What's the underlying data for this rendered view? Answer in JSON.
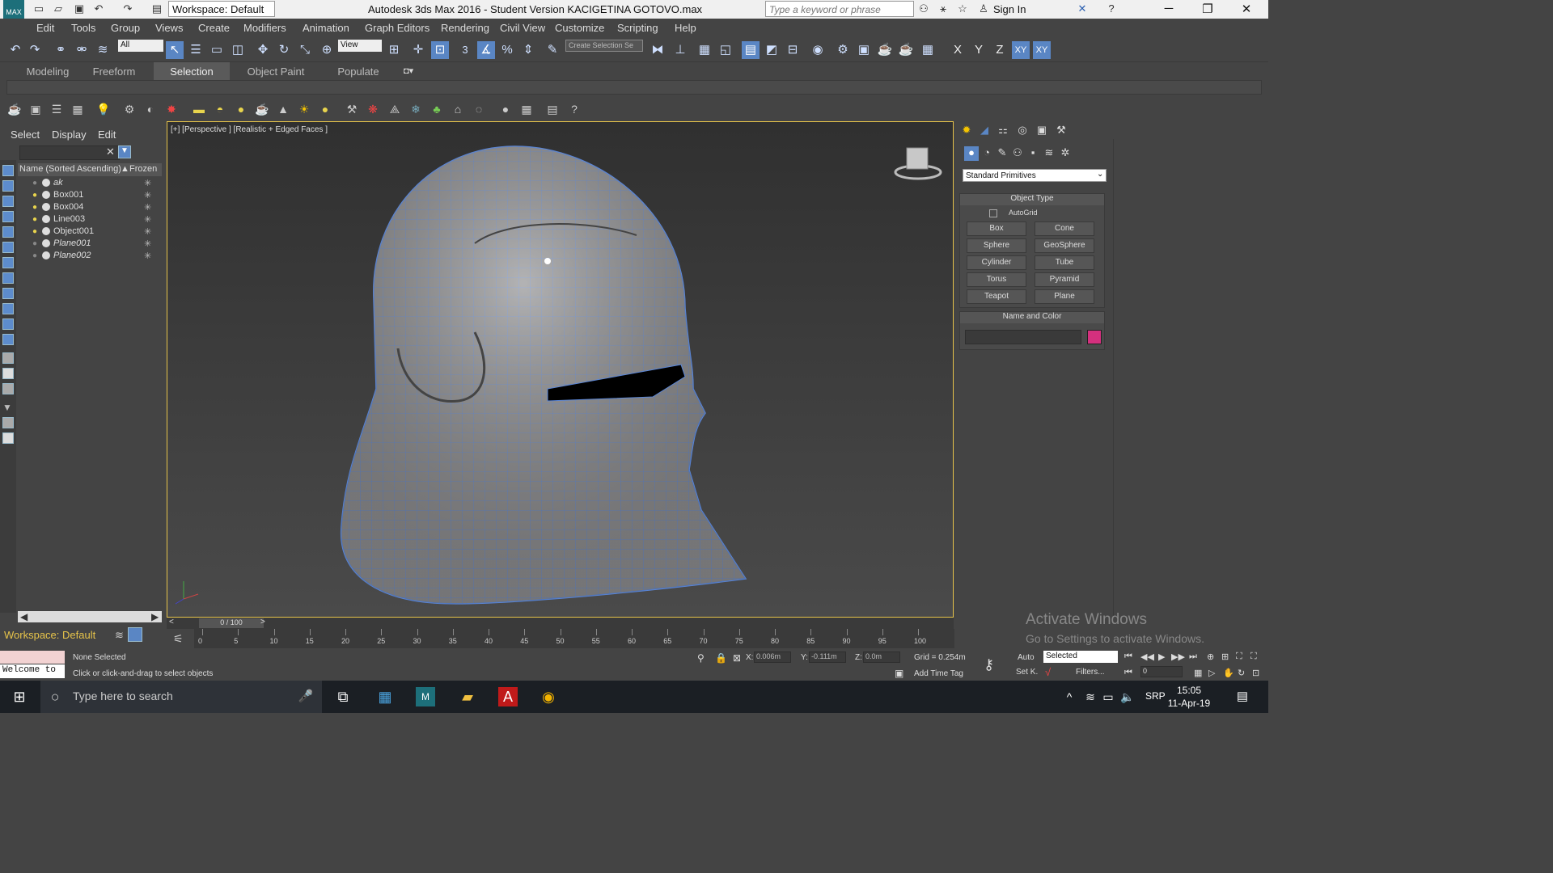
{
  "titlebar": {
    "title": "Autodesk 3ds Max 2016 - Student Version    KACIGETINA GOTOVO.max",
    "workspace": "Workspace: Default",
    "search_placeholder": "Type a keyword or phrase",
    "signin": "Sign In"
  },
  "menu": [
    "Edit",
    "Tools",
    "Group",
    "Views",
    "Create",
    "Modifiers",
    "Animation",
    "Graph Editors",
    "Rendering",
    "Civil View",
    "Customize",
    "Scripting",
    "Help"
  ],
  "toolbar": {
    "filter": "All",
    "refcoord": "View",
    "selset": "Create Selection Se",
    "axes": [
      "X",
      "Y",
      "Z",
      "XY",
      "XY"
    ],
    "snap_num": "3"
  },
  "ribbon_tabs": [
    "Modeling",
    "Freeform",
    "Selection",
    "Object Paint",
    "Populate"
  ],
  "ribbon_active": "Selection",
  "explorer": {
    "tabs": [
      "Select",
      "Display",
      "Edit"
    ],
    "header_name": "Name (Sorted Ascending)",
    "header_frozen": "Frozen",
    "rows": [
      {
        "name": "ak",
        "lit": false
      },
      {
        "name": "Box001",
        "lit": true
      },
      {
        "name": "Box004",
        "lit": true
      },
      {
        "name": "Line003",
        "lit": true
      },
      {
        "name": "Object001",
        "lit": true
      },
      {
        "name": "Plane001",
        "lit": false
      },
      {
        "name": "Plane002",
        "lit": false
      }
    ]
  },
  "viewport": {
    "label": "[+] [Perspective ] [Realistic + Edged Faces ]"
  },
  "command_panel": {
    "dropdown": "Standard Primitives",
    "object_type_title": "Object Type",
    "autogrid": "AutoGrid",
    "buttons": [
      "Box",
      "Cone",
      "Sphere",
      "GeoSphere",
      "Cylinder",
      "Tube",
      "Torus",
      "Pyramid",
      "Teapot",
      "Plane"
    ],
    "name_color_title": "Name and Color",
    "swatch_color": "#d4307e"
  },
  "timeline": {
    "frame": "0 / 100",
    "ticks": [
      "0",
      "5",
      "10",
      "15",
      "20",
      "25",
      "30",
      "35",
      "40",
      "45",
      "50",
      "55",
      "60",
      "65",
      "70",
      "75",
      "80",
      "85",
      "90",
      "95",
      "100"
    ]
  },
  "status": {
    "workspace": "Workspace: Default",
    "welcome": "Welcome to",
    "none_selected": "None Selected",
    "prompt": "Click or click-and-drag to select objects",
    "x": "0.006m",
    "y": "-0.111m",
    "z": "0.0m",
    "grid": "Grid = 0.254m",
    "add_time_tag": "Add Time Tag",
    "auto": "Auto",
    "setk": "Set K.",
    "selected": "Selected",
    "filters": "Filters...",
    "frame_field": "0"
  },
  "taskbar": {
    "search": "Type here to search",
    "lang": "SRP",
    "time": "15:05",
    "date": "11-Apr-19"
  },
  "watermark": {
    "line1": "Activate Windows",
    "line2": "Go to Settings to activate Windows."
  }
}
